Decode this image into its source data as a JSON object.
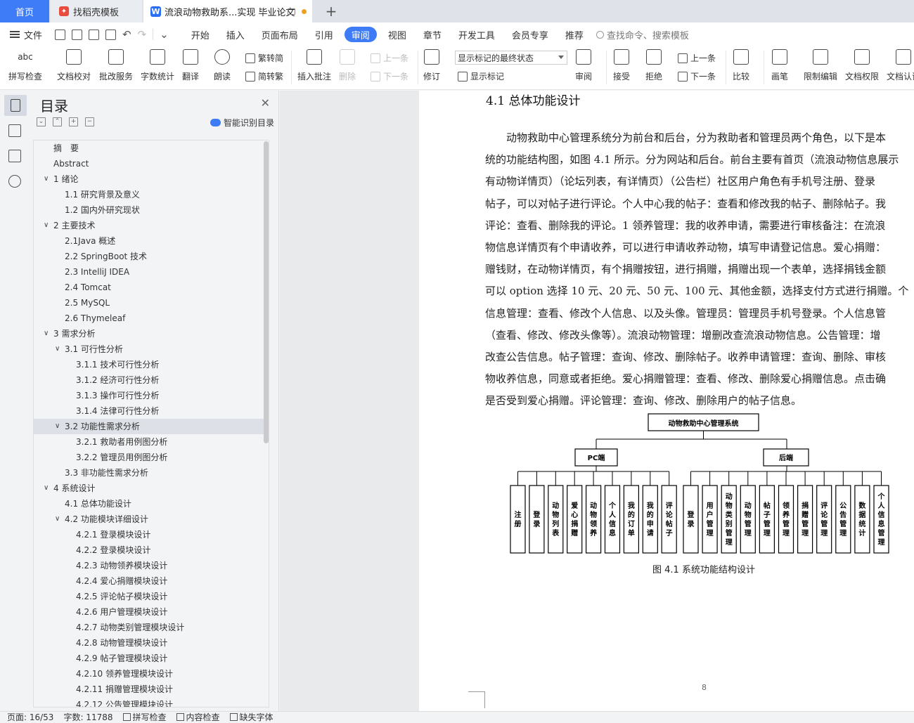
{
  "tabs": {
    "home": "首页",
    "straw": "找稻壳模板",
    "doc": "流浪动物救助系...实现 毕业论文",
    "new_tab": "+"
  },
  "menubar": {
    "file": "文件",
    "menus": [
      "开始",
      "插入",
      "页面布局",
      "引用",
      "审阅",
      "视图",
      "章节",
      "开发工具",
      "会员专享",
      "推荐"
    ],
    "active_menu": "审阅",
    "search_placeholder": "查找命令、搜索模板"
  },
  "ribbon": {
    "spell_check": "拼写检查",
    "doc_proof": "文档校对",
    "batch_service": "批改服务",
    "word_count": "字数统计",
    "translate": "翻译",
    "read_aloud": "朗读",
    "trad_to_simp": "繁转简",
    "simp_to_trad": "简转繁",
    "insert_comment": "插入批注",
    "delete": "删除",
    "prev_comment": "上一条",
    "next_comment": "下一条",
    "track_changes": "修订",
    "markup_state": "显示标记的最终状态",
    "show_markup": "显示标记",
    "review": "审阅",
    "accept": "接受",
    "reject": "拒绝",
    "prev_change": "上一条",
    "next_change": "下一条",
    "compare": "比较",
    "pen": "画笔",
    "restrict_edit": "限制编辑",
    "doc_permission": "文档权限",
    "doc_cert": "文档认证"
  },
  "toc": {
    "title": "目录",
    "smart": "智能识别目录",
    "items": [
      {
        "text": "摘　要",
        "level": 0,
        "chev": ""
      },
      {
        "text": "Abstract",
        "level": 0,
        "chev": ""
      },
      {
        "text": "1  绪论",
        "level": 0,
        "chev": "v"
      },
      {
        "text": "1.1 研究背景及意义",
        "level": 1,
        "chev": ""
      },
      {
        "text": "1.2 国内外研究现状",
        "level": 1,
        "chev": ""
      },
      {
        "text": "2  主要技术",
        "level": 0,
        "chev": "v"
      },
      {
        "text": "2.1Java 概述",
        "level": 1,
        "chev": ""
      },
      {
        "text": "2.2 SpringBoot 技术",
        "level": 1,
        "chev": ""
      },
      {
        "text": "2.3 IntelliJ IDEA",
        "level": 1,
        "chev": ""
      },
      {
        "text": "2.4 Tomcat",
        "level": 1,
        "chev": ""
      },
      {
        "text": "2.5 MySQL",
        "level": 1,
        "chev": ""
      },
      {
        "text": "2.6 Thymeleaf",
        "level": 1,
        "chev": ""
      },
      {
        "text": "3  需求分析",
        "level": 0,
        "chev": "v"
      },
      {
        "text": "3.1 可行性分析",
        "level": 1,
        "chev": "v"
      },
      {
        "text": "3.1.1  技术可行性分析",
        "level": 2,
        "chev": ""
      },
      {
        "text": "3.1.2  经济可行性分析",
        "level": 2,
        "chev": ""
      },
      {
        "text": "3.1.3  操作可行性分析",
        "level": 2,
        "chev": ""
      },
      {
        "text": "3.1.4  法律可行性分析",
        "level": 2,
        "chev": ""
      },
      {
        "text": "3.2  功能性需求分析",
        "level": 1,
        "chev": "v",
        "selected": true
      },
      {
        "text": "3.2.1 救助者用例图分析",
        "level": 2,
        "chev": ""
      },
      {
        "text": "3.2.2  管理员用例图分析",
        "level": 2,
        "chev": ""
      },
      {
        "text": "3.3  非功能性需求分析",
        "level": 1,
        "chev": ""
      },
      {
        "text": "4  系统设计",
        "level": 0,
        "chev": "v"
      },
      {
        "text": "4.1  总体功能设计",
        "level": 1,
        "chev": ""
      },
      {
        "text": "4.2  功能模块详细设计",
        "level": 1,
        "chev": "v"
      },
      {
        "text": "4.2.1  登录模块设计",
        "level": 2,
        "chev": ""
      },
      {
        "text": "4.2.2  登录模块设计",
        "level": 2,
        "chev": ""
      },
      {
        "text": "4.2.3  动物领养模块设计",
        "level": 2,
        "chev": ""
      },
      {
        "text": "4.2.4 爱心捐赠模块设计",
        "level": 2,
        "chev": ""
      },
      {
        "text": "4.2.5 评论帖子模块设计",
        "level": 2,
        "chev": ""
      },
      {
        "text": "4.2.6 用户管理模块设计",
        "level": 2,
        "chev": ""
      },
      {
        "text": "4.2.7 动物类别管理模块设计",
        "level": 2,
        "chev": ""
      },
      {
        "text": "4.2.8 动物管理模块设计",
        "level": 2,
        "chev": ""
      },
      {
        "text": "4.2.9 帖子管理模块设计",
        "level": 2,
        "chev": ""
      },
      {
        "text": "4.2.10 领养管理模块设计",
        "level": 2,
        "chev": ""
      },
      {
        "text": "4.2.11 捐赠管理模块设计",
        "level": 2,
        "chev": ""
      },
      {
        "text": "4.2.12 公告管理模块设计",
        "level": 2,
        "chev": ""
      }
    ]
  },
  "document": {
    "heading": "4.1  总体功能设计",
    "lines": [
      "　　动物救助中心管理系统分为前台和后台，分为救助者和管理员两个角色，以下是本",
      "统的功能结构图，如图 4.1 所示。分为网站和后台。前台主要有首页（流浪动物信息展示",
      "有动物详情页）（论坛列表，有详情页）（公告栏）社区用户角色有手机号注册、登录",
      "帖子，可以对帖子进行评论。个人中心我的帖子：查看和修改我的帖子、删除帖子。我",
      "评论：查看、删除我的评论。1 领养管理：我的收养申请，需要进行审核备注：在流浪",
      "物信息详情页有个申请收养，可以进行申请收养动物，填写申请登记信息。爱心捐赠：",
      "赠钱财，在动物详情页，有个捐赠按钮，进行捐赠，捐赠出现一个表单，选择捐钱金额",
      "可以 option 选择 10 元、20 元、50 元、100 元、其他金额，选择支付方式进行捐赠。个",
      "信息管理：查看、修改个人信息、以及头像。管理员：管理员手机号登录。个人信息管",
      "（查看、修改、修改头像等）。流浪动物管理：增删改查流浪动物信息。公告管理：增",
      "改查公告信息。帖子管理：查询、修改、删除帖子。收养申请管理：查询、删除、审核",
      "物收养信息，同意或者拒绝。爱心捐赠管理：查看、修改、删除爱心捐赠信息。点击确",
      "是否受到爱心捐赠。评论管理：查询、修改、删除用户的帖子信息。"
    ],
    "figure": {
      "root": "动物救助中心管理系统",
      "pc": "PC端",
      "backend": "后端",
      "pc_leaves": [
        "注册",
        "登录",
        "动物列表",
        "爱心捐赠",
        "动物领养",
        "个人信息",
        "我的订单",
        "我的申请",
        "评论帖子"
      ],
      "backend_leaves": [
        "登录",
        "用户管理",
        "动物类别管理",
        "动物管理",
        "帖子管理",
        "领养管理",
        "捐赠管理",
        "评论管理",
        "公告管理",
        "数据统计",
        "个人信息管理"
      ]
    },
    "caption": "图 4.1 系统功能结构设计",
    "page_number": "8"
  },
  "status": {
    "page": "页面: 16/53",
    "words": "字数: 11788",
    "spell": "拼写检查",
    "content": "内容检查",
    "font": "缺失字体"
  }
}
